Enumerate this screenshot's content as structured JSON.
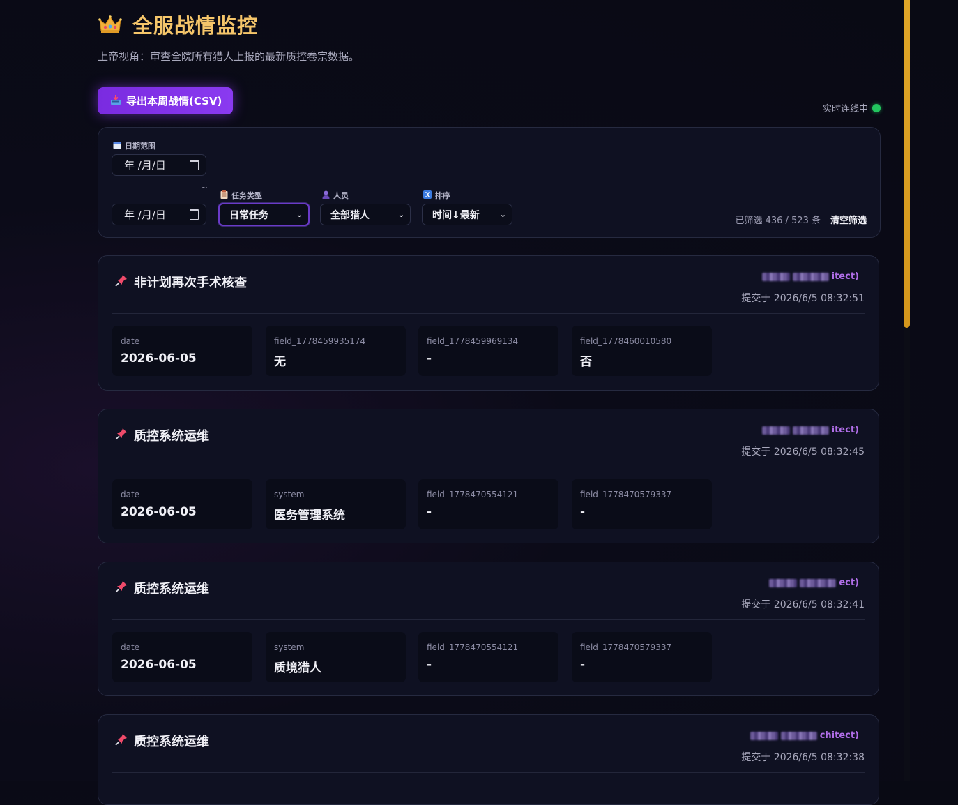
{
  "header": {
    "title": "全服战情监控",
    "subtitle": "上帝视角：审查全院所有猎人上报的最新质控卷宗数据。",
    "export_label": "导出本周战情(CSV)",
    "live_status": "实时连线中"
  },
  "filters": {
    "date_range_label": "日期范围",
    "date_start_placeholder": "年 /月/日",
    "date_end_placeholder": "年 /月/日",
    "tilde": "~",
    "task_type_label": "任务类型",
    "task_type_value": "日常任务",
    "person_label": "人员",
    "person_value": "全部猎人",
    "sort_label": "排序",
    "sort_value": "时间↓最新",
    "count_text": "已筛选 436 / 523 条",
    "clear_label": "清空筛选"
  },
  "cards": [
    {
      "title": "非计划再次手术核查",
      "user_suffix": "itect)",
      "time": "提交于 2026/6/5 08:32:51",
      "fields": [
        {
          "key": "date",
          "value": "2026-06-05"
        },
        {
          "key": "field_1778459935174",
          "value": "无"
        },
        {
          "key": "field_1778459969134",
          "value": "-"
        },
        {
          "key": "field_1778460010580",
          "value": "否"
        }
      ]
    },
    {
      "title": "质控系统运维",
      "user_suffix": "itect)",
      "time": "提交于 2026/6/5 08:32:45",
      "fields": [
        {
          "key": "date",
          "value": "2026-06-05"
        },
        {
          "key": "system",
          "value": "医务管理系统"
        },
        {
          "key": "field_1778470554121",
          "value": "-"
        },
        {
          "key": "field_1778470579337",
          "value": "-"
        }
      ]
    },
    {
      "title": "质控系统运维",
      "user_suffix": "ect)",
      "time": "提交于 2026/6/5 08:32:41",
      "fields": [
        {
          "key": "date",
          "value": "2026-06-05"
        },
        {
          "key": "system",
          "value": "质境猎人"
        },
        {
          "key": "field_1778470554121",
          "value": "-"
        },
        {
          "key": "field_1778470579337",
          "value": "-"
        }
      ]
    },
    {
      "title": "质控系统运维",
      "user_suffix": "chitect)",
      "time": "提交于 2026/6/5 08:32:38",
      "fields": []
    }
  ],
  "icons": {
    "crown": "crown-icon",
    "export": "inbox-tray-icon",
    "calendar": "calendar-icon",
    "task": "clipboard-icon",
    "person": "person-icon",
    "sort": "shuffle-icon",
    "card": "pushpin-icon"
  },
  "colors": {
    "title": "#f5c56a",
    "accent": "#7a2be0",
    "live": "#22c55e",
    "user": "#b06ee8",
    "card_icon": "#ef4a6a"
  }
}
